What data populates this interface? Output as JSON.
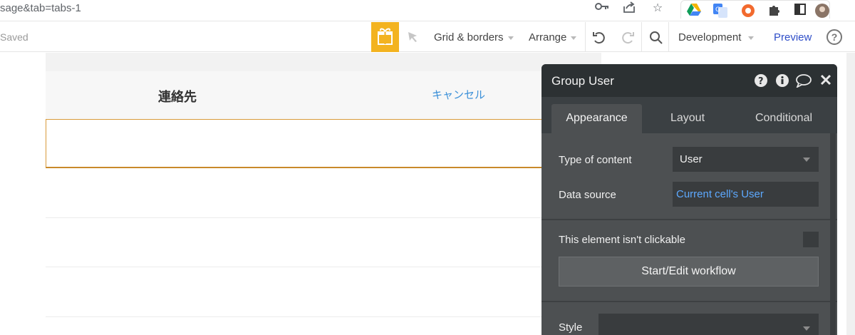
{
  "browser": {
    "url_fragment": "sage&tab=tabs-1",
    "icons": [
      "key-icon",
      "share-icon",
      "star-icon",
      "google-drive-icon",
      "google-translate-icon",
      "extension-orange-icon",
      "puzzle-icon",
      "window-icon",
      "profile-avatar"
    ]
  },
  "toolbar": {
    "saved_label": "Saved",
    "grid_label": "Grid & borders",
    "arrange_label": "Arrange",
    "development_label": "Development",
    "preview_label": "Preview",
    "help_label": "?",
    "accent_color": "#f3b320"
  },
  "canvas": {
    "title": "連絡先",
    "cancel_label": "キャンセル"
  },
  "panel": {
    "title": "Group User",
    "tabs": [
      {
        "label": "Appearance",
        "active": true
      },
      {
        "label": "Layout",
        "active": false
      },
      {
        "label": "Conditional",
        "active": false
      }
    ],
    "type_of_content_label": "Type of content",
    "type_of_content_value": "User",
    "data_source_label": "Data source",
    "data_source_value": "Current cell's User",
    "clickable_label": "This element isn't clickable",
    "workflow_label": "Start/Edit workflow",
    "style_label": "Style",
    "link_color": "#5da9ff"
  }
}
